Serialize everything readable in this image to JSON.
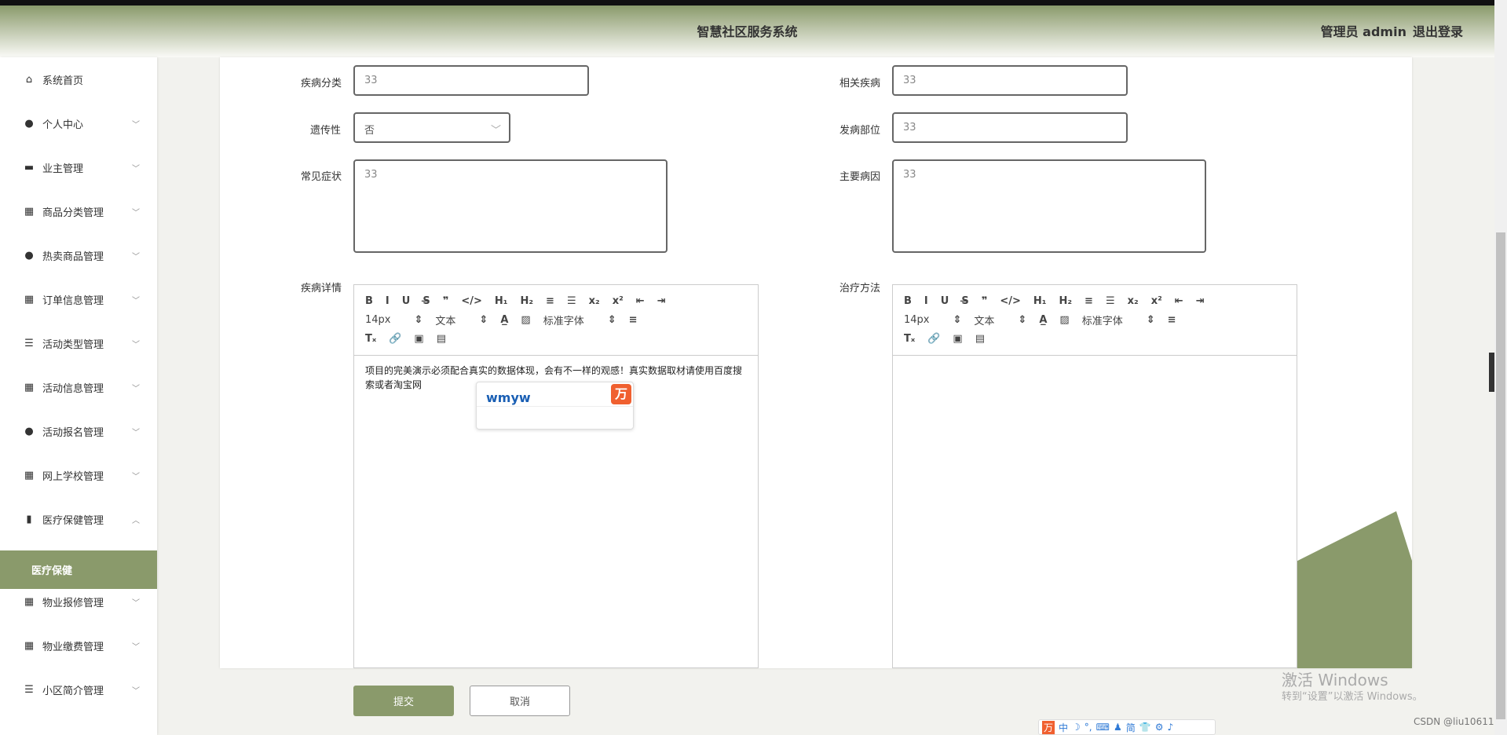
{
  "header": {
    "title": "智慧社区服务系统",
    "user": "管理员 admin",
    "logout": "退出登录"
  },
  "sidebar": {
    "items": [
      {
        "label": "系统首页",
        "icon": "home-icon",
        "glyph": "⌂",
        "chevron": ""
      },
      {
        "label": "个人中心",
        "icon": "user-icon",
        "glyph": "●",
        "chevron": "﹀"
      },
      {
        "label": "业主管理",
        "icon": "briefcase-icon",
        "glyph": "▬",
        "chevron": "﹀"
      },
      {
        "label": "商品分类管理",
        "icon": "grid-icon",
        "glyph": "▦",
        "chevron": "﹀"
      },
      {
        "label": "热卖商品管理",
        "icon": "user-icon",
        "glyph": "●",
        "chevron": "﹀"
      },
      {
        "label": "订单信息管理",
        "icon": "grid-icon",
        "glyph": "▦",
        "chevron": "﹀"
      },
      {
        "label": "活动类型管理",
        "icon": "sliders-icon",
        "glyph": "☰",
        "chevron": "﹀"
      },
      {
        "label": "活动信息管理",
        "icon": "grid-icon",
        "glyph": "▦",
        "chevron": "﹀"
      },
      {
        "label": "活动报名管理",
        "icon": "user-icon",
        "glyph": "●",
        "chevron": "﹀"
      },
      {
        "label": "网上学校管理",
        "icon": "grid-icon",
        "glyph": "▦",
        "chevron": "﹀"
      },
      {
        "label": "医疗保健管理",
        "icon": "bar-chart-icon",
        "glyph": "▮",
        "chevron": "︿"
      },
      {
        "label": "医疗保健",
        "icon": "",
        "glyph": "",
        "chevron": ""
      },
      {
        "label": "物业报修管理",
        "icon": "grid-icon",
        "glyph": "▦",
        "chevron": "﹀"
      },
      {
        "label": "物业缴费管理",
        "icon": "grid-icon",
        "glyph": "▦",
        "chevron": "﹀"
      },
      {
        "label": "小区简介管理",
        "icon": "list-icon",
        "glyph": "☰",
        "chevron": "﹀"
      }
    ]
  },
  "form": {
    "category_label": "疾病分类",
    "category_value": "33",
    "related_label": "相关疾病",
    "related_value": "33",
    "hereditary_label": "遗传性",
    "hereditary_value": "否",
    "site_label": "发病部位",
    "site_value": "33",
    "symptoms_label": "常见症状",
    "symptoms_value": "33",
    "cause_label": "主要病因",
    "cause_value": "33",
    "detail_label": "疾病详情",
    "treatment_label": "治疗方法",
    "detail_content": "项目的完美演示必须配合真实的数据体现，会有不一样的观感！真实数据取材请使用百度搜索或者淘宝网",
    "submit": "提交",
    "cancel": "取消"
  },
  "editor": {
    "size": "14px",
    "block": "文本",
    "font": "标准字体"
  },
  "ime": {
    "code": "wmyw",
    "tray": [
      "中",
      "☽",
      "°,",
      "⌨",
      "♟",
      "简",
      "👕",
      "⚙",
      "♪"
    ]
  },
  "watermark": {
    "line1": "激活 Windows",
    "line2": "转到“设置”以激活 Windows。",
    "csdn": "CSDN @liu10611"
  },
  "colors": {
    "accent": "#8a9a6b"
  }
}
